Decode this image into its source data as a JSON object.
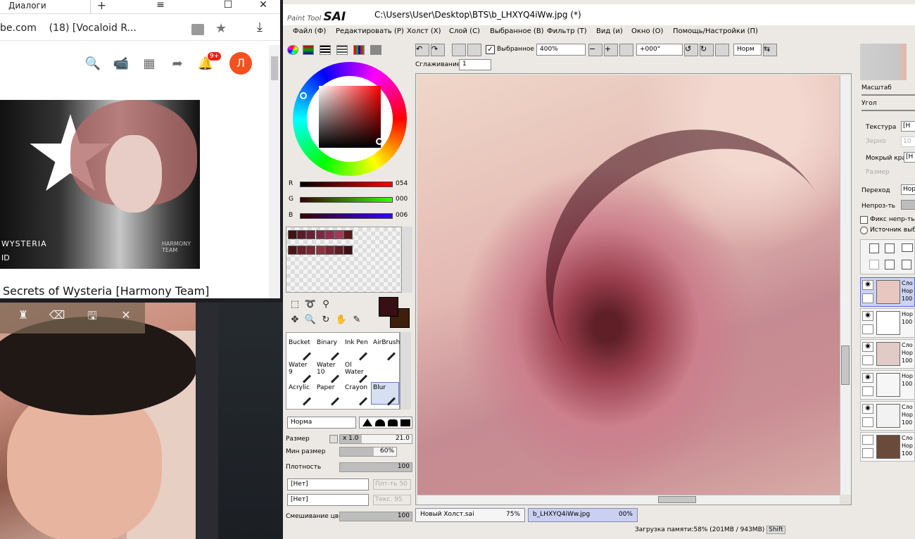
{
  "browser": {
    "tab_title": "Диалоги",
    "new_tab": "+",
    "win_min": "≡",
    "win_restore": "☐",
    "win_close": "✕",
    "url_site": "be.com",
    "url_title": "(18) [Vocaloid R...",
    "star": "★",
    "download": "⤓",
    "yt_search": "🔍",
    "yt_camera": "📹",
    "yt_apps": "▦",
    "yt_share": "➦",
    "yt_bell": "🔔",
    "yt_badge": "9+",
    "yt_avatar": "Л",
    "thumb_text1": "WYSTERIA",
    "thumb_text2": "ID",
    "thumb_wm": "HARMONY TEAM",
    "video_title": "Secrets of Wysteria [Harmony Team]"
  },
  "photo_toolbar": {
    "brush_icon": "♜",
    "eraser_icon": "⌫",
    "save_icon": "🖫",
    "close_icon": "✕"
  },
  "sai": {
    "logo_small": "Paint Tool",
    "logo_big": "SAI",
    "path": "C:\\Users\\User\\Desktop\\BTS\\b_LHXYQ4iWw.jpg (*)",
    "menu": [
      "Файл (Ф)",
      "Редактировать (Р)",
      "Холст (Х)",
      "Слой (С)",
      "Выбранное (В)",
      "Фильтр (Т)",
      "Вид (и)",
      "Окно (О)",
      "Помощь/Настройки (П)"
    ],
    "toolbar": {
      "selected_label": "Выбранное",
      "zoom": "400%",
      "angle": "+000°",
      "blend": "Норм",
      "smoothing_label": "Сглаживание",
      "smoothing_value": "1"
    },
    "color": {
      "r_label": "R",
      "r_value": "054",
      "g_label": "G",
      "g_value": "000",
      "b_label": "B",
      "b_value": "006",
      "fg": "#361014",
      "bg": "#3f1f0b"
    },
    "swatches_row1": [
      "#3e1217",
      "#5a1a28",
      "#6a2037",
      "#7c2a44",
      "#8f2d4f",
      "#a3385b",
      "#5b1a1f"
    ],
    "swatches_row2": [
      "#4a1418",
      "#6b1e27",
      "#7c2631",
      "#8e323e",
      "#7a2530",
      "#5c1b22",
      "#3d1016"
    ],
    "brushes": [
      {
        "name": "Bucket",
        "sub": ""
      },
      {
        "name": "Binary",
        "sub": ""
      },
      {
        "name": "Ink Pen",
        "sub": ""
      },
      {
        "name": "AirBrush",
        "sub": ""
      },
      {
        "name": "Water",
        "sub": "9"
      },
      {
        "name": "Water",
        "sub": "10"
      },
      {
        "name": "Ol Water",
        "sub": ""
      },
      {
        "name": "",
        "sub": ""
      },
      {
        "name": "Acrylic",
        "sub": ""
      },
      {
        "name": "Paper",
        "sub": ""
      },
      {
        "name": "Crayon",
        "sub": ""
      },
      {
        "name": "Blur",
        "sub": ""
      }
    ],
    "brush_mode": "Норма",
    "size_label": "Размер",
    "size_mult": "x 1.0",
    "size_value": "21.0",
    "minsize_label": "Мин размер",
    "minsize_value": "60%",
    "minsize_fraction": 0.6,
    "density_label": "Плотность",
    "density_value": "100",
    "density_fraction": 1.0,
    "drop1": "[Нет]",
    "drop1_txt": "Плт-ть",
    "drop1_num": "50",
    "drop2": "[Нет]",
    "drop2_txt": "Текс.",
    "drop2_num": "95",
    "blend_label": "Смешивание цвет",
    "blend_value": "100",
    "blend_fraction": 1.0,
    "docs": [
      {
        "name": "Новый Холст.sai",
        "zoom": "75%"
      },
      {
        "name": "b_LHXYQ4iWw.jpg",
        "zoom": "00%"
      }
    ],
    "status": "Загрузка памяти:58% (201MB / 943MB)",
    "status_shift": "Shift",
    "right": {
      "scale": "Масштаб",
      "angle": "Угол",
      "texture": "Текстура",
      "texture_val": "[Н",
      "grain": "Зерно",
      "grain_val": "10",
      "wet_edge": "Мокрый край",
      "wet_val": "[Н",
      "size": "Размер",
      "transition": "Переход",
      "transition_val": "Нор",
      "opacity": "Непроз-ть",
      "fix_opacity": "Фикс непр-ть",
      "source": "Источник выбо"
    },
    "layers": [
      {
        "name": "Сло",
        "mode": "Нор",
        "op": "100"
      },
      {
        "name": "",
        "mode": "Нор",
        "op": "100"
      },
      {
        "name": "Сло",
        "mode": "Нор",
        "op": "100"
      },
      {
        "name": "",
        "mode": "Нор",
        "op": "100"
      },
      {
        "name": "Сло",
        "mode": "Нор",
        "op": "100"
      },
      {
        "name": "Сло",
        "mode": "Нор",
        "op": "100"
      }
    ]
  }
}
